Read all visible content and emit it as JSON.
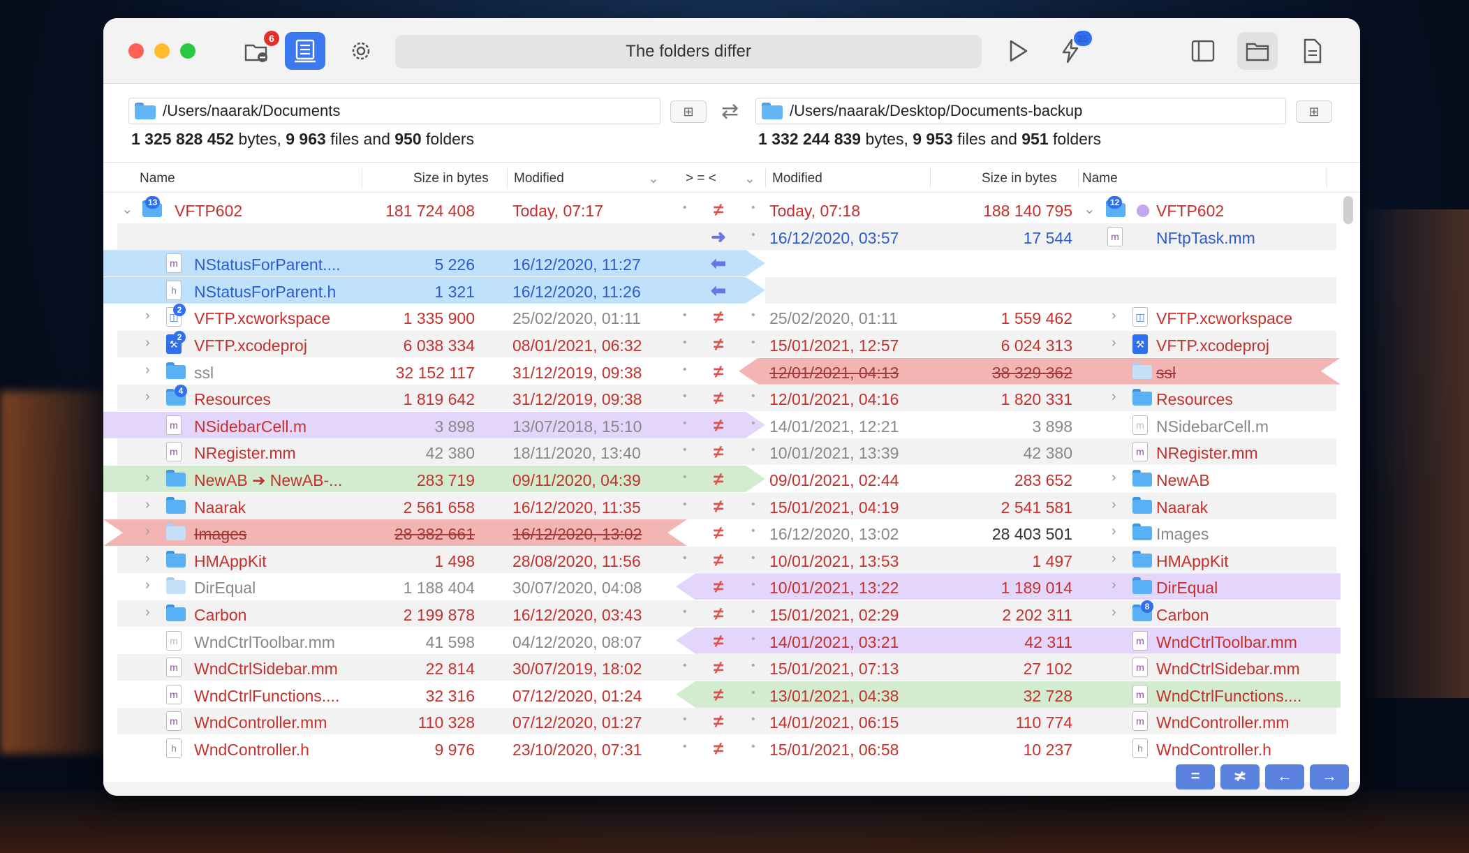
{
  "toolbar": {
    "status_text": "The folders differ",
    "history_badge": "6",
    "actions_badge": "25"
  },
  "left": {
    "path": "/Users/naarak/Documents",
    "bytes": "1 325 828 452",
    "files": "9 963",
    "folders": "950"
  },
  "right": {
    "path": "/Users/naarak/Desktop/Documents-backup",
    "bytes": "1 332 244 839",
    "files": "9 953",
    "folders": "951"
  },
  "summary_words": {
    "bytes": "bytes,",
    "files": "files and",
    "folders": "folders"
  },
  "columns": {
    "name": "Name",
    "size": "Size in bytes",
    "modified": "Modified",
    "compare": "> = <",
    "r_modified": "Modified",
    "r_size": "Size in bytes",
    "r_name": "Name"
  },
  "rows": [
    {
      "ln": "VFTP602",
      "ls": "181 724 408",
      "lm": "Today, 07:17",
      "rm": "Today, 07:18",
      "rs": "188 140 795",
      "rn": "VFTP602"
    },
    {
      "ln": "",
      "ls": "",
      "lm": "",
      "rm": "16/12/2020, 03:57",
      "rs": "17 544",
      "rn": "NFtpTask.mm"
    },
    {
      "ln": "NStatusForParent....",
      "ls": "5 226",
      "lm": "16/12/2020, 11:27",
      "rm": "",
      "rs": "",
      "rn": ""
    },
    {
      "ln": "NStatusForParent.h",
      "ls": "1 321",
      "lm": "16/12/2020, 11:26",
      "rm": "",
      "rs": "",
      "rn": ""
    },
    {
      "ln": "VFTP.xcworkspace",
      "ls": "1 335 900",
      "lm": "25/02/2020, 01:11",
      "rm": "25/02/2020, 01:11",
      "rs": "1 559 462",
      "rn": "VFTP.xcworkspace"
    },
    {
      "ln": "VFTP.xcodeproj",
      "ls": "6 038 334",
      "lm": "08/01/2021, 06:32",
      "rm": "15/01/2021, 12:57",
      "rs": "6 024 313",
      "rn": "VFTP.xcodeproj"
    },
    {
      "ln": "ssl",
      "ls": "32 152 117",
      "lm": "31/12/2019, 09:38",
      "rm": "12/01/2021, 04:13",
      "rs": "38 329 362",
      "rn": "ssl"
    },
    {
      "ln": "Resources",
      "ls": "1 819 642",
      "lm": "31/12/2019, 09:38",
      "rm": "12/01/2021, 04:16",
      "rs": "1 820 331",
      "rn": "Resources"
    },
    {
      "ln": "NSidebarCell.m",
      "ls": "3 898",
      "lm": "13/07/2018, 15:10",
      "rm": "14/01/2021, 12:21",
      "rs": "3 898",
      "rn": "NSidebarCell.m"
    },
    {
      "ln": "NRegister.mm",
      "ls": "42 380",
      "lm": "18/11/2020, 13:40",
      "rm": "10/01/2021, 13:39",
      "rs": "42 380",
      "rn": "NRegister.mm"
    },
    {
      "ln": "NewAB ➔ NewAB-...",
      "ls": "283 719",
      "lm": "09/11/2020, 04:39",
      "rm": "09/01/2021, 02:44",
      "rs": "283 652",
      "rn": "NewAB"
    },
    {
      "ln": "Naarak",
      "ls": "2 561 658",
      "lm": "16/12/2020, 11:35",
      "rm": "15/01/2021, 04:19",
      "rs": "2 541 581",
      "rn": "Naarak"
    },
    {
      "ln": "Images",
      "ls": "28 382 661",
      "lm": "16/12/2020, 13:02",
      "rm": "16/12/2020, 13:02",
      "rs": "28 403 501",
      "rn": "Images"
    },
    {
      "ln": "HMAppKit",
      "ls": "1 498",
      "lm": "28/08/2020, 11:56",
      "rm": "10/01/2021, 13:53",
      "rs": "1 497",
      "rn": "HMAppKit"
    },
    {
      "ln": "DirEqual",
      "ls": "1 188 404",
      "lm": "30/07/2020, 04:08",
      "rm": "10/01/2021, 13:22",
      "rs": "1 189 014",
      "rn": "DirEqual"
    },
    {
      "ln": "Carbon",
      "ls": "2 199 878",
      "lm": "16/12/2020, 03:43",
      "rm": "15/01/2021, 02:29",
      "rs": "2 202 311",
      "rn": "Carbon"
    },
    {
      "ln": "WndCtrlToolbar.mm",
      "ls": "41 598",
      "lm": "04/12/2020, 08:07",
      "rm": "14/01/2021, 03:21",
      "rs": "42 311",
      "rn": "WndCtrlToolbar.mm"
    },
    {
      "ln": "WndCtrlSidebar.mm",
      "ls": "22 814",
      "lm": "30/07/2019, 18:02",
      "rm": "15/01/2021, 07:13",
      "rs": "27 102",
      "rn": "WndCtrlSidebar.mm"
    },
    {
      "ln": "WndCtrlFunctions....",
      "ls": "32 316",
      "lm": "07/12/2020, 01:24",
      "rm": "13/01/2021, 04:38",
      "rs": "32 728",
      "rn": "WndCtrlFunctions...."
    },
    {
      "ln": "WndController.mm",
      "ls": "110 328",
      "lm": "07/12/2020, 01:27",
      "rm": "14/01/2021, 06:15",
      "rs": "110 774",
      "rn": "WndController.mm"
    },
    {
      "ln": "WndController.h",
      "ls": "9 976",
      "lm": "23/10/2020, 07:31",
      "rm": "15/01/2021, 06:58",
      "rs": "10 237",
      "rn": "WndController.h"
    }
  ],
  "badges": {
    "root_left": "13",
    "root_right": "12",
    "xcworkspace": "2",
    "xcodeproj": "2",
    "resources": "4",
    "carbon": "8"
  },
  "footer_buttons": [
    "=",
    "≭",
    "←",
    "→"
  ],
  "colors": {
    "accent": "#3c78f0",
    "diff_red": "#c4302b",
    "blue_text": "#2c5bd0",
    "hl_blue": "#bfe1fb",
    "hl_purple": "#e3d6fa",
    "hl_green": "#d3ecd0",
    "hl_red": "#f3b4b4"
  }
}
